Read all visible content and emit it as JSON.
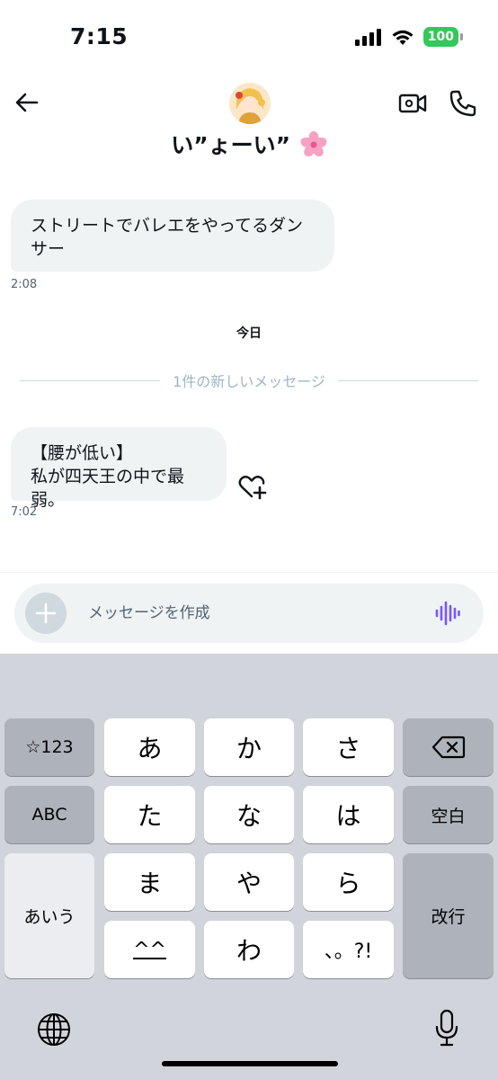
{
  "status_bar": {
    "time": "7:15",
    "battery": "100",
    "icons": [
      "signal-icon",
      "wifi-icon",
      "battery-icon"
    ]
  },
  "header": {
    "back_icon": "back-arrow-icon",
    "contact_name": "い”ょーい”",
    "name_emoji_icon": "cherry-blossom-icon",
    "video_icon": "video-call-icon",
    "phone_icon": "phone-icon"
  },
  "messages": [
    {
      "text": "ストリートでバレエをやってるダンサー",
      "time": "2:08"
    },
    {
      "text_line1": "【腰が低い】",
      "text_line2": "私が四天王の中で最弱。",
      "time": "7:02"
    }
  ],
  "date_divider": "今日",
  "new_messages_label": "1件の新しいメッセージ",
  "composer": {
    "placeholder": "メッセージを作成",
    "add_icon": "plus-icon",
    "voice_icon": "voice-wave-icon"
  },
  "keyboard": {
    "row1": [
      "☆123",
      "あ",
      "か",
      "さ"
    ],
    "row2": [
      "ABC",
      "た",
      "な",
      "は",
      "空白"
    ],
    "row3": [
      "あいう",
      "ま",
      "や",
      "ら",
      "改行"
    ],
    "row4": [
      "^^",
      "わ",
      "、。?!"
    ],
    "delete_icon": "backspace-icon",
    "globe_icon": "globe-icon",
    "mic_icon": "microphone-icon"
  },
  "colors": {
    "bubble_bg": "#eff3f4",
    "battery": "#34c759",
    "voice_accent": "#7856ff",
    "keyboard_bg": "#d1d4da"
  }
}
